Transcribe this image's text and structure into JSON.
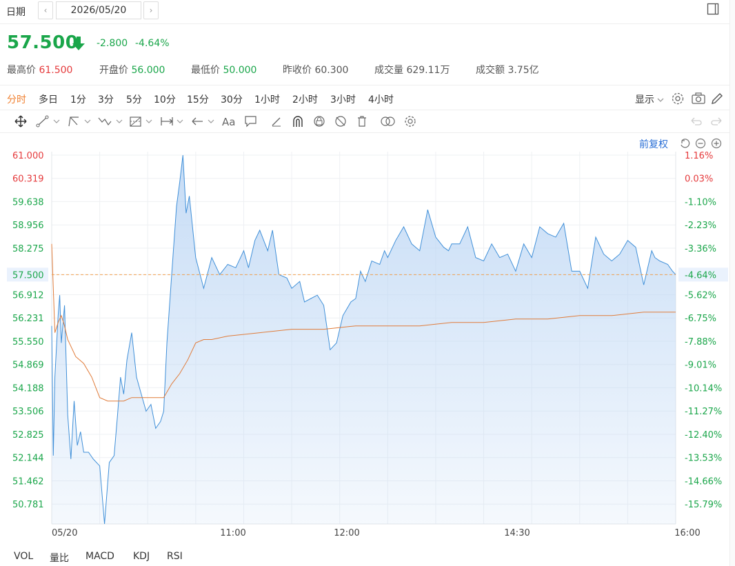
{
  "header": {
    "date_label": "日期",
    "date_value": "2026/05/20",
    "prev_label": "‹",
    "next_label": "›"
  },
  "quote": {
    "price": "57.500",
    "change": "-2.800",
    "change_pct": "-4.64%",
    "direction_icon": "arrow-down-icon",
    "color_down": "#1aa64a",
    "color_up": "#e5393b"
  },
  "stats": [
    {
      "label": "最高价",
      "value": "61.500",
      "tone": "red"
    },
    {
      "label": "开盘价",
      "value": "56.000",
      "tone": "green"
    },
    {
      "label": "最低价",
      "value": "50.000",
      "tone": "green"
    },
    {
      "label": "昨收价",
      "value": "60.300",
      "tone": "dark"
    },
    {
      "label": "成交量",
      "value": "629.11万",
      "tone": "dark"
    },
    {
      "label": "成交额",
      "value": "3.75亿",
      "tone": "dark"
    }
  ],
  "periods": [
    "分时",
    "多日",
    "1分",
    "3分",
    "5分",
    "10分",
    "15分",
    "30分",
    "1小时",
    "2小时",
    "3小时",
    "4小时"
  ],
  "active_period": "分时",
  "display_label": "显示",
  "toolbar_icons": [
    "move-icon",
    "line-tool-icon",
    "channel-tool-icon",
    "wave-tool-icon",
    "fib-tool-icon",
    "range-tool-icon",
    "arrow-tool-icon",
    "text-tool-icon",
    "comment-tool-icon",
    "pencil-tool-icon",
    "magnet-icon",
    "lock-drawings-icon",
    "hide-drawings-icon",
    "delete-drawings-icon",
    "compare-icon",
    "chart-settings-icon"
  ],
  "adjust_label": "前复权",
  "bottom_tabs": [
    "VOL",
    "量比",
    "MACD",
    "KDJ",
    "RSI"
  ],
  "chart_data": {
    "type": "line",
    "prev_close": 60.3,
    "current": 57.5,
    "left_ticks": [
      "61.000",
      "60.319",
      "59.638",
      "58.956",
      "58.275",
      "57.500",
      "56.912",
      "56.231",
      "55.550",
      "54.869",
      "54.188",
      "53.506",
      "52.825",
      "52.144",
      "51.462",
      "50.781"
    ],
    "right_ticks": [
      "1.16%",
      "0.03%",
      "-1.10%",
      "-2.23%",
      "-3.36%",
      "-4.64%",
      "-5.62%",
      "-6.75%",
      "-7.88%",
      "-9.01%",
      "-10.14%",
      "-11.27%",
      "-12.40%",
      "-13.53%",
      "-14.66%",
      "-15.79%"
    ],
    "x_labels": [
      "05/20",
      "11:00",
      "12:00",
      "14:30",
      "16:00"
    ],
    "ylim": [
      50.2,
      61.1
    ],
    "x_minutes_range": [
      570,
      960
    ],
    "series": [
      {
        "color": "#3f8fd8",
        "x": [
          570,
          571,
          572,
          574,
          575,
          576,
          578,
          580,
          582,
          584,
          586,
          588,
          590,
          593,
          596,
          600,
          603,
          606,
          609,
          611,
          613,
          615,
          617,
          620,
          623,
          626,
          629,
          632,
          635,
          638,
          640,
          642,
          645,
          648,
          650,
          652,
          654,
          656,
          660,
          665,
          670,
          675,
          680,
          685,
          690,
          693,
          697,
          700,
          705,
          708,
          712,
          717,
          720,
          725,
          728,
          732,
          736,
          740,
          744,
          748,
          752,
          757,
          760,
          763,
          766,
          770,
          775,
          778,
          780,
          785,
          790,
          795,
          800,
          805,
          810,
          815,
          818,
          820,
          825,
          830,
          835,
          840,
          845,
          850,
          855,
          860,
          865,
          870,
          875,
          880,
          885,
          890,
          895,
          900,
          905,
          910,
          915,
          920,
          925,
          930,
          935,
          940,
          945,
          947,
          950,
          955,
          958,
          960
        ],
        "y": [
          56.0,
          52.2,
          54.5,
          56.3,
          56.9,
          55.5,
          56.6,
          53.4,
          52.1,
          53.8,
          52.5,
          52.9,
          52.3,
          52.3,
          52.1,
          51.9,
          50.2,
          52.0,
          52.2,
          53.3,
          54.5,
          54.0,
          55.0,
          55.8,
          54.5,
          54.0,
          53.5,
          53.7,
          53.0,
          53.2,
          53.5,
          55.5,
          57.5,
          59.5,
          60.2,
          61.0,
          59.3,
          59.8,
          58.0,
          57.1,
          58.0,
          57.5,
          57.8,
          57.7,
          58.2,
          57.7,
          58.5,
          58.8,
          58.2,
          58.8,
          57.5,
          57.4,
          57.1,
          57.3,
          56.7,
          56.8,
          56.9,
          56.6,
          55.3,
          55.5,
          56.3,
          56.7,
          56.8,
          57.6,
          57.3,
          57.9,
          57.8,
          58.2,
          58.0,
          58.5,
          58.9,
          58.4,
          58.2,
          59.4,
          58.6,
          58.3,
          58.2,
          58.4,
          58.4,
          58.9,
          58.0,
          57.9,
          58.4,
          58.0,
          58.1,
          57.6,
          58.4,
          58.0,
          58.9,
          58.7,
          58.6,
          59.0,
          57.6,
          57.6,
          57.1,
          58.6,
          58.1,
          57.9,
          58.1,
          58.5,
          58.3,
          57.2,
          58.2,
          58.0,
          57.9,
          57.8,
          57.6,
          57.5
        ]
      },
      {
        "color": "#e07b39",
        "x": [
          570,
          572,
          574,
          576,
          578,
          580,
          585,
          590,
          595,
          600,
          605,
          610,
          615,
          620,
          625,
          630,
          635,
          640,
          645,
          650,
          655,
          660,
          665,
          670,
          680,
          700,
          720,
          740,
          760,
          780,
          800,
          820,
          840,
          860,
          880,
          900,
          920,
          940,
          960
        ],
        "y": [
          58.4,
          55.8,
          56.1,
          56.3,
          56.0,
          55.6,
          55.1,
          54.9,
          54.5,
          53.9,
          53.8,
          53.8,
          53.8,
          53.9,
          53.9,
          53.9,
          53.9,
          53.9,
          54.3,
          54.6,
          55.0,
          55.5,
          55.6,
          55.6,
          55.7,
          55.8,
          55.9,
          55.9,
          56.0,
          56.0,
          56.0,
          56.1,
          56.1,
          56.2,
          56.2,
          56.3,
          56.3,
          56.4,
          56.4
        ]
      }
    ]
  }
}
